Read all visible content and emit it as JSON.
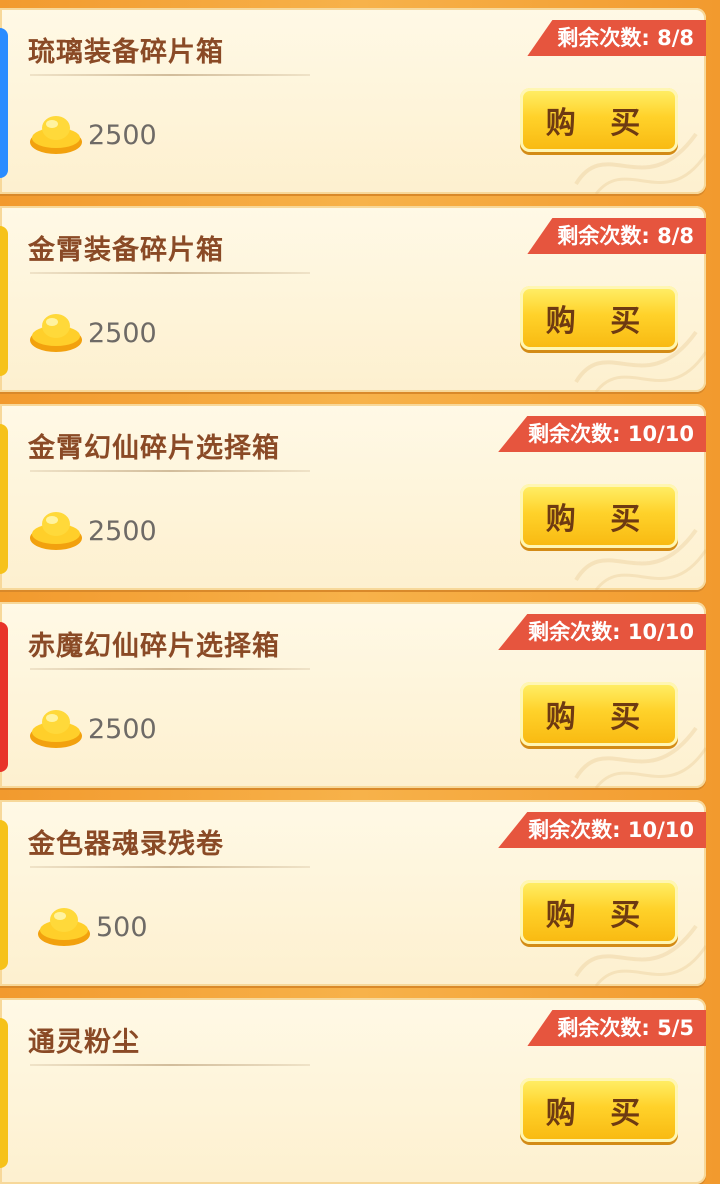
{
  "shop": {
    "items": [
      {
        "name": "琉璃装备碎片箱",
        "price": "2500",
        "remaining": "剩余次数: 8/8",
        "buy_label": "购 买",
        "thumb_color": "#2a8cff"
      },
      {
        "name": "金霄装备碎片箱",
        "price": "2500",
        "remaining": "剩余次数: 8/8",
        "buy_label": "购 买",
        "thumb_color": "#f6c21a"
      },
      {
        "name": "金霄幻仙碎片选择箱",
        "price": "2500",
        "remaining": "剩余次数: 10/10",
        "buy_label": "购 买",
        "thumb_color": "#f6c21a"
      },
      {
        "name": "赤魔幻仙碎片选择箱",
        "price": "2500",
        "remaining": "剩余次数: 10/10",
        "buy_label": "购 买",
        "thumb_color": "#e8332a"
      },
      {
        "name": "金色器魂录残卷",
        "price": "500",
        "remaining": "剩余次数: 10/10",
        "buy_label": "购 买",
        "thumb_color": "#f6c21a"
      },
      {
        "name": "通灵粉尘",
        "price": "",
        "remaining": "剩余次数: 5/5",
        "buy_label": "购 买",
        "thumb_color": "#f6c21a"
      }
    ]
  },
  "colors": {
    "badge": "#e6553e",
    "title": "#8a4a26",
    "button": "#ffd22a",
    "background": "#f29a2e"
  },
  "icons": {
    "currency": "gold-ingot-icon"
  }
}
